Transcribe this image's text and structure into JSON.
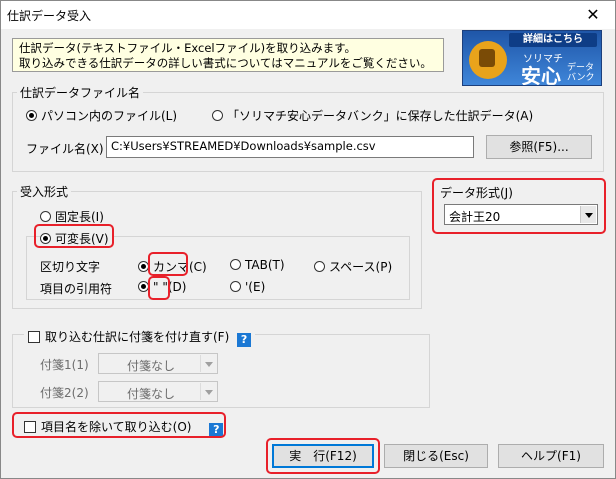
{
  "window": {
    "title": "仕訳データ受入",
    "close_glyph": "✕"
  },
  "info": {
    "line1": "仕訳データ(テキストファイル・Excelファイル)を取り込みます。",
    "line2": "取り込みできる仕訳データの詳しい書式についてはマニュアルをご覧ください。"
  },
  "banner": {
    "top": "詳細はこちら",
    "brand": "ソリマチ",
    "big": "安心",
    "sub": "データ バンク"
  },
  "file_group": {
    "legend": "仕訳データファイル名",
    "radio_local": "パソコン内のファイル(L)",
    "radio_bank": "「ソリマチ安心データバンク」に保存した仕訳データ(A)",
    "filename_label": "ファイル名(X)",
    "filename_value": "C:¥Users¥STREAMED¥Downloads¥sample.csv",
    "browse_button": "参照(F5)..."
  },
  "format_group": {
    "legend": "受入形式",
    "fixed": "固定長(I)",
    "variable": "可変長(V)",
    "delimiter_label": "区切り文字",
    "comma": "カンマ(C)",
    "tab": "TAB(T)",
    "space": "スペース(P)",
    "quote_label": "項目の引用符",
    "double_quote": "\" \"(D)",
    "single_quote": "'(E)"
  },
  "data_format": {
    "label": "データ形式(J)",
    "selected": "会計王20"
  },
  "tag_group": {
    "label": "取り込む仕訳に付箋を付け直す(F)",
    "help": "?",
    "tag1_label": "付箋1(1)",
    "tag1_value": "付箋なし",
    "tag2_label": "付箋2(2)",
    "tag2_value": "付箋なし"
  },
  "exclude": {
    "label": "項目名を除いて取り込む(O)",
    "help": "?"
  },
  "buttons": {
    "run": "実　行(F12)",
    "close": "閉じる(Esc)",
    "help": "ヘルプ(F1)"
  },
  "colors": {
    "highlight": "#e8202a",
    "help_icon": "#1b78d4",
    "info_bg": "#ffffe1"
  }
}
